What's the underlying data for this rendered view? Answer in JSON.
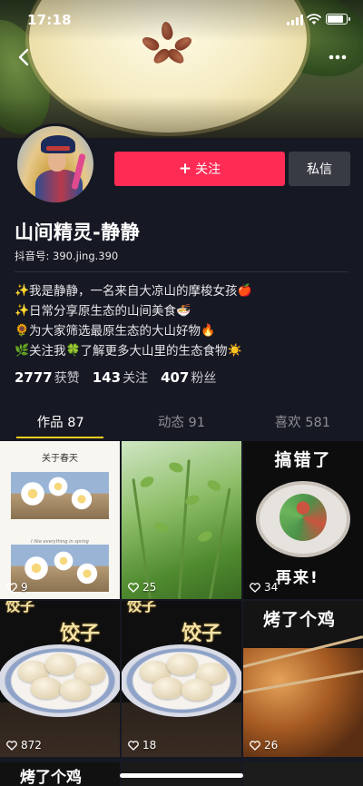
{
  "status_bar": {
    "time": "17:18"
  },
  "nav": {
    "back_icon": "chevron-left-icon",
    "more_icon": "more-dots-icon"
  },
  "profile": {
    "name": "山间精灵-静静",
    "uid_label": "抖音号: 390.jing.390",
    "follow_label": "关注",
    "message_label": "私信",
    "bio": [
      {
        "emoji": "✨",
        "text": "我是静静，一名来自大凉山的摩梭女孩",
        "end_emoji": "🍎"
      },
      {
        "emoji": "✨",
        "text": "日常分享原生态的山间美食",
        "end_emoji": "🍜"
      },
      {
        "emoji": "🌻",
        "text": "为大家筛选最原生态的大山好物",
        "end_emoji": "🔥"
      },
      {
        "emoji": "🌿",
        "text": "关注我",
        "mid_emoji": "🍀",
        "text2": "了解更多大山里的生态食物",
        "end_emoji": "☀️"
      }
    ],
    "stats": [
      {
        "value": "2777",
        "label": "获赞"
      },
      {
        "value": "143",
        "label": "关注"
      },
      {
        "value": "407",
        "label": "粉丝"
      }
    ]
  },
  "tabs": [
    {
      "label": "作品 87",
      "active": true
    },
    {
      "label": "动态 91",
      "active": false
    },
    {
      "label": "喜欢 581",
      "active": false
    }
  ],
  "videos": [
    {
      "likes": "9",
      "title": "关于春天",
      "caption": "I like everything in spring"
    },
    {
      "likes": "25"
    },
    {
      "likes": "34",
      "text_top": "搞错了",
      "text_bottom": "再来!"
    },
    {
      "likes": "872",
      "text": "饺子",
      "text_top": "饺子"
    },
    {
      "likes": "18",
      "text": "饺子",
      "text_top": "饺子"
    },
    {
      "likes": "26",
      "text": "烤了个鸡"
    }
  ],
  "partial_row": [
    {
      "text": "烤了个鸡"
    }
  ],
  "colors": {
    "background": "#161823",
    "follow_button": "#fe2c55",
    "message_button": "#393b44",
    "tab_indicator": "#facd1e"
  }
}
